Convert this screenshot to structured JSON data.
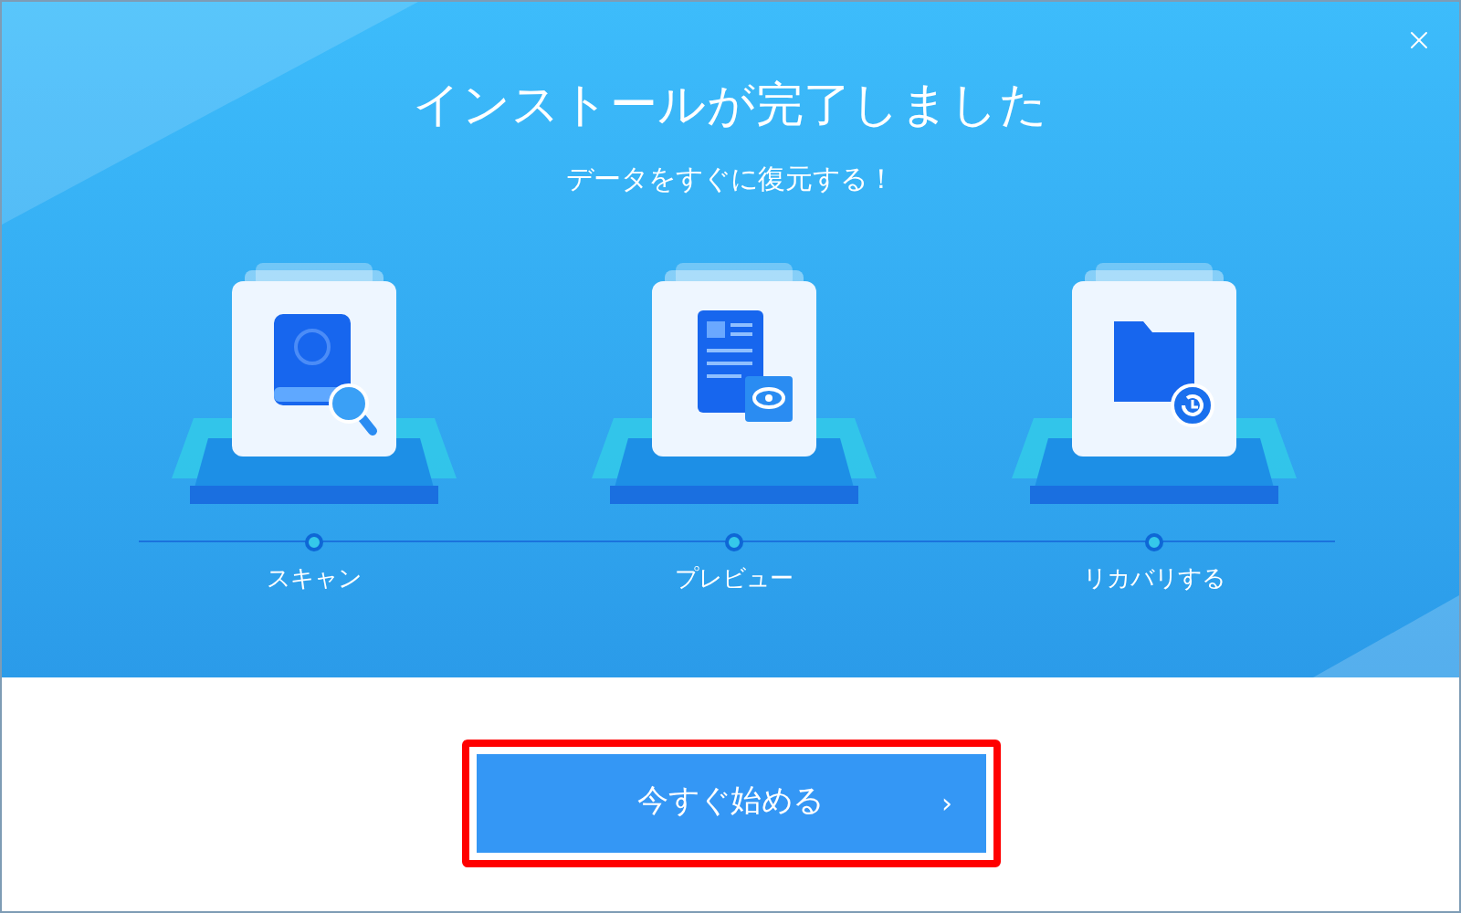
{
  "header": {
    "title": "インストールが完了しました",
    "subtitle": "データをすぐに復元する！"
  },
  "steps": [
    {
      "kind": "scan",
      "label": "スキャン"
    },
    {
      "kind": "preview",
      "label": "プレビュー"
    },
    {
      "kind": "recover",
      "label": "リカバリする"
    }
  ],
  "start_button": {
    "label": "今すぐ始める",
    "arrow": "›",
    "highlighted": true
  }
}
